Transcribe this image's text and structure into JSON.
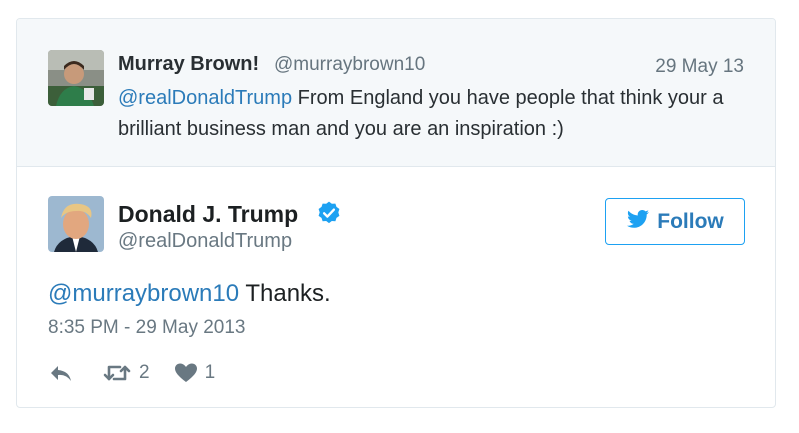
{
  "parent_tweet": {
    "author_name": "Murray Brown!",
    "author_handle": "@murraybrown10",
    "date": "29 May 13",
    "mention": "@realDonaldTrump",
    "text": " From England you have people that think your a brilliant business man and you are an inspiration :)"
  },
  "main_tweet": {
    "author_name": "Donald J. Trump",
    "author_handle": "@realDonaldTrump",
    "verified": true,
    "follow_label": "Follow",
    "mention": "@murraybrown10",
    "text": " Thanks.",
    "timestamp": "8:35 PM - 29 May 2013",
    "retweet_count": "2",
    "like_count": "1"
  },
  "colors": {
    "link": "#2b7bb9",
    "brand_blue": "#1da1f2",
    "muted": "#697882",
    "parent_bg": "#f5f8fa"
  },
  "icons": [
    "reply-icon",
    "retweet-icon",
    "heart-icon",
    "twitter-bird-icon",
    "verified-badge-icon"
  ]
}
